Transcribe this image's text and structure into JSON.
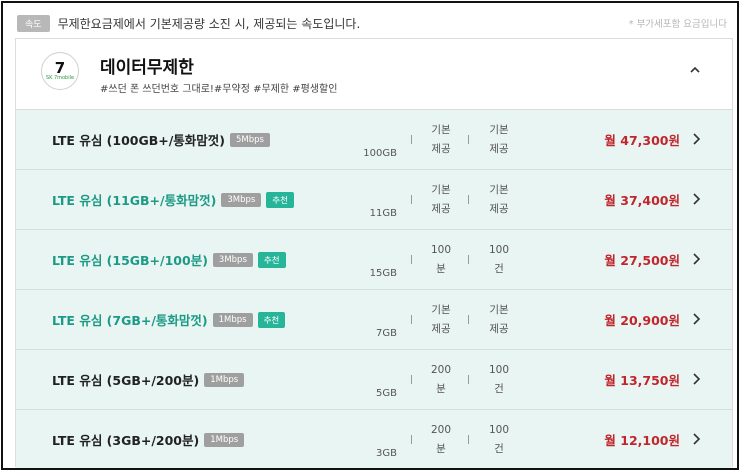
{
  "notice": {
    "chip": "속도",
    "text": "무제한요금제에서 기본제공량 소진 시, 제공되는 속도입니다.",
    "vat": "* 부가세포함 요금입니다"
  },
  "plan": {
    "logo_mark": "7",
    "logo_sub": "SK 7mobile",
    "name": "데이터무제한",
    "tags": "#쓰던 폰 쓰던번호 그대로!#무약정 #무제한 #평생할인"
  },
  "rows": [
    {
      "name": "LTE 유심 (100GB+/통화맘껏)",
      "speed": "5Mbps",
      "rec": "",
      "teal": false,
      "data": "100GB",
      "voice": "기본제공",
      "sms": "기본제공",
      "price": "월 47,300원"
    },
    {
      "name": "LTE 유심 (11GB+/통화맘껏)",
      "speed": "3Mbps",
      "rec": "추천",
      "teal": true,
      "data": "11GB",
      "voice": "기본제공",
      "sms": "기본제공",
      "price": "월 37,400원"
    },
    {
      "name": "LTE 유심 (15GB+/100분)",
      "speed": "3Mbps",
      "rec": "추천",
      "teal": true,
      "data": "15GB",
      "voice": "100분",
      "sms": "100건",
      "price": "월 27,500원"
    },
    {
      "name": "LTE 유심 (7GB+/통화맘껏)",
      "speed": "1Mbps",
      "rec": "추천",
      "teal": true,
      "data": "7GB",
      "voice": "기본제공",
      "sms": "기본제공",
      "price": "월 20,900원"
    },
    {
      "name": "LTE 유심 (5GB+/200분)",
      "speed": "1Mbps",
      "rec": "",
      "teal": false,
      "data": "5GB",
      "voice": "200분",
      "sms": "100건",
      "price": "월 13,750원"
    },
    {
      "name": "LTE 유심 (3GB+/200분)",
      "speed": "1Mbps",
      "rec": "",
      "teal": false,
      "data": "3GB",
      "voice": "200분",
      "sms": "100건",
      "price": "월 12,100원"
    }
  ]
}
